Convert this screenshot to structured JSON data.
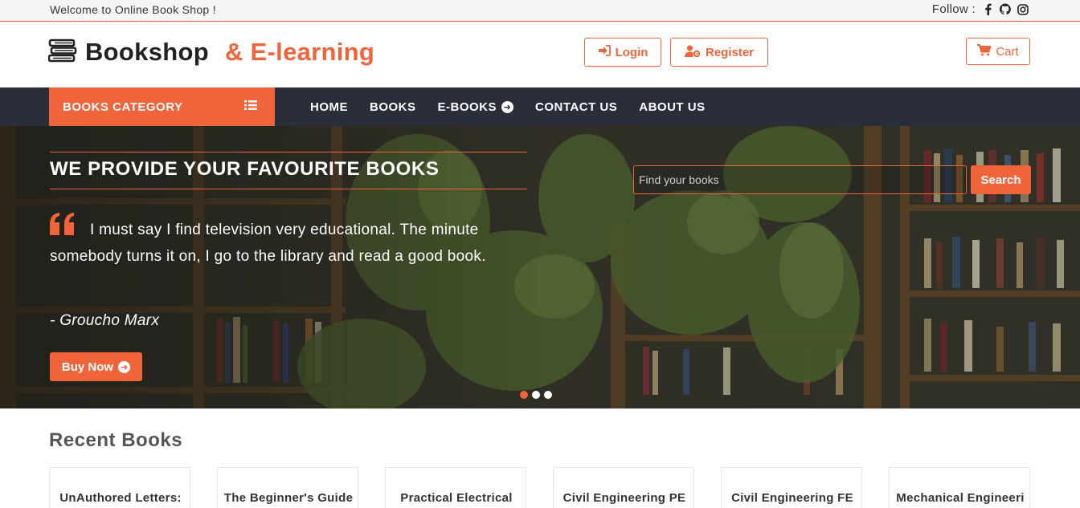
{
  "topbar": {
    "welcome": "Welcome to Online Book Shop !",
    "follow_label": "Follow :",
    "social_icons": [
      "facebook-icon",
      "github-icon",
      "instagram-icon"
    ]
  },
  "header": {
    "brand": "Bookshop",
    "brand_accent": "& E-learning",
    "login_label": "Login",
    "register_label": "Register",
    "cart_label": "Cart"
  },
  "nav": {
    "category_label": "BOOKS CATEGORY",
    "items": [
      {
        "label": "HOME"
      },
      {
        "label": "BOOKS"
      },
      {
        "label": "E-BOOKS"
      },
      {
        "label": "CONTACT US"
      },
      {
        "label": "ABOUT US"
      }
    ]
  },
  "hero": {
    "title": "WE PROVIDE YOUR FAVOURITE BOOKS",
    "quote": "I must say I find television very educational. The minute somebody turns it on, I go to the library and read a good book.",
    "author": "- Groucho Marx",
    "buy_label": "Buy Now",
    "search_placeholder": "Find your books",
    "search_button": "Search",
    "slides": 3,
    "active_slide": 1
  },
  "recent": {
    "title": "Recent Books",
    "books": [
      {
        "title": "UnAuthored Letters:"
      },
      {
        "title": "The Beginner's Guide"
      },
      {
        "title": "Practical Electrical"
      },
      {
        "title": "Civil Engineering PE"
      },
      {
        "title": "Civil Engineering FE"
      },
      {
        "title": "Mechanical Engineeri"
      }
    ]
  },
  "colors": {
    "accent": "#f0643c",
    "nav_bg": "#2a2e38"
  }
}
